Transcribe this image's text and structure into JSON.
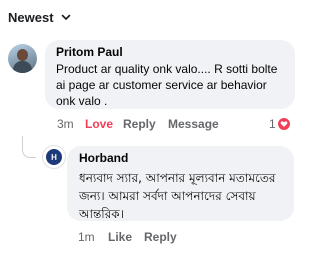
{
  "sort": {
    "label": "Newest",
    "icon": "chevron-down-icon"
  },
  "comments": [
    {
      "author": "Pritom Paul",
      "text": "Product ar quality onk valo.... R sotti bolte ai page ar customer service ar behavior onk valo .",
      "time": "3m",
      "reaction_label": "Love",
      "reply_label": "Reply",
      "message_label": "Message",
      "reaction_count": "1",
      "reaction_color": "#f33e58"
    }
  ],
  "reply": {
    "author": "Horband",
    "avatar_logo_text": "H",
    "text": "ধন্যবাদ স্যার, আপনার মূল্যবান মতামতের জন্য। আমরা সর্বদা আপনাদের সেবায় আন্তরিক।",
    "time": "1m",
    "like_label": "Like",
    "reply_label": "Reply"
  }
}
